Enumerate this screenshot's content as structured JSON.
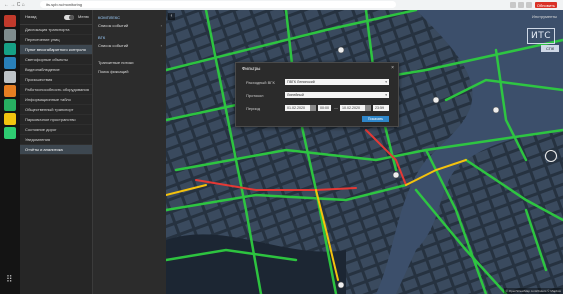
{
  "browser": {
    "nav": "← → C ⌂",
    "url": "its.spb.ru/monitoring",
    "extensions": [
      "",
      "",
      ""
    ],
    "badge": "Обновить"
  },
  "menu": {
    "left_label": "Назад",
    "right_label": "Меню",
    "items": [
      {
        "label": "Дислокация транспорта",
        "active": false
      },
      {
        "label": "Пересечение улиц",
        "active": false
      },
      {
        "label": "Пункт весогабаритного контроля",
        "active": true
      },
      {
        "label": "Светофорные объекты",
        "active": false
      },
      {
        "label": "Видеонаблюдение",
        "active": false
      },
      {
        "label": "Происшествия",
        "active": false
      },
      {
        "label": "Работоспособность оборудования",
        "active": false
      },
      {
        "label": "Информационные табло",
        "active": false
      },
      {
        "label": "Общественный транспорт",
        "active": false
      },
      {
        "label": "Парковочное пространство",
        "active": false
      },
      {
        "label": "Состояние дорог",
        "active": false
      },
      {
        "label": "Уведомления",
        "active": false
      },
      {
        "label": "Отчёты и аналитика",
        "active": true
      }
    ]
  },
  "submenu": {
    "sections": [
      {
        "header": "КОМПЛЕКС",
        "rows": [
          {
            "label": "Список событий",
            "arrow": "›"
          }
        ]
      },
      {
        "header": "ВГК",
        "rows": [
          {
            "label": "Список событий",
            "arrow": "›"
          }
        ]
      },
      {
        "header": "",
        "rows": [
          {
            "label": "Транзитные потоки",
            "arrow": ""
          },
          {
            "label": "Поиск фиксаций",
            "arrow": ""
          }
        ]
      }
    ]
  },
  "dialog": {
    "title": "Фильтры",
    "close": "×",
    "fields": [
      {
        "label": "Расходный ВГК",
        "value": "ПВГК Ленинский"
      },
      {
        "label": "Протокол",
        "value": "Линейный"
      }
    ],
    "period_label": "Период",
    "date_from": "01.02.2020",
    "time_from": "00:00",
    "date_to": "10.02.2020",
    "time_to": "23:59",
    "apply": "Показать"
  },
  "map": {
    "back": "‹",
    "info": "Инструменты",
    "logo_text": "ИТС",
    "logo_sub": "СПб",
    "attribution": "© OpenStreetMap contributors © Mapbox",
    "road_color": "#2ecc40",
    "jam_color": "#e53935",
    "slow_color": "#f4c20d"
  }
}
